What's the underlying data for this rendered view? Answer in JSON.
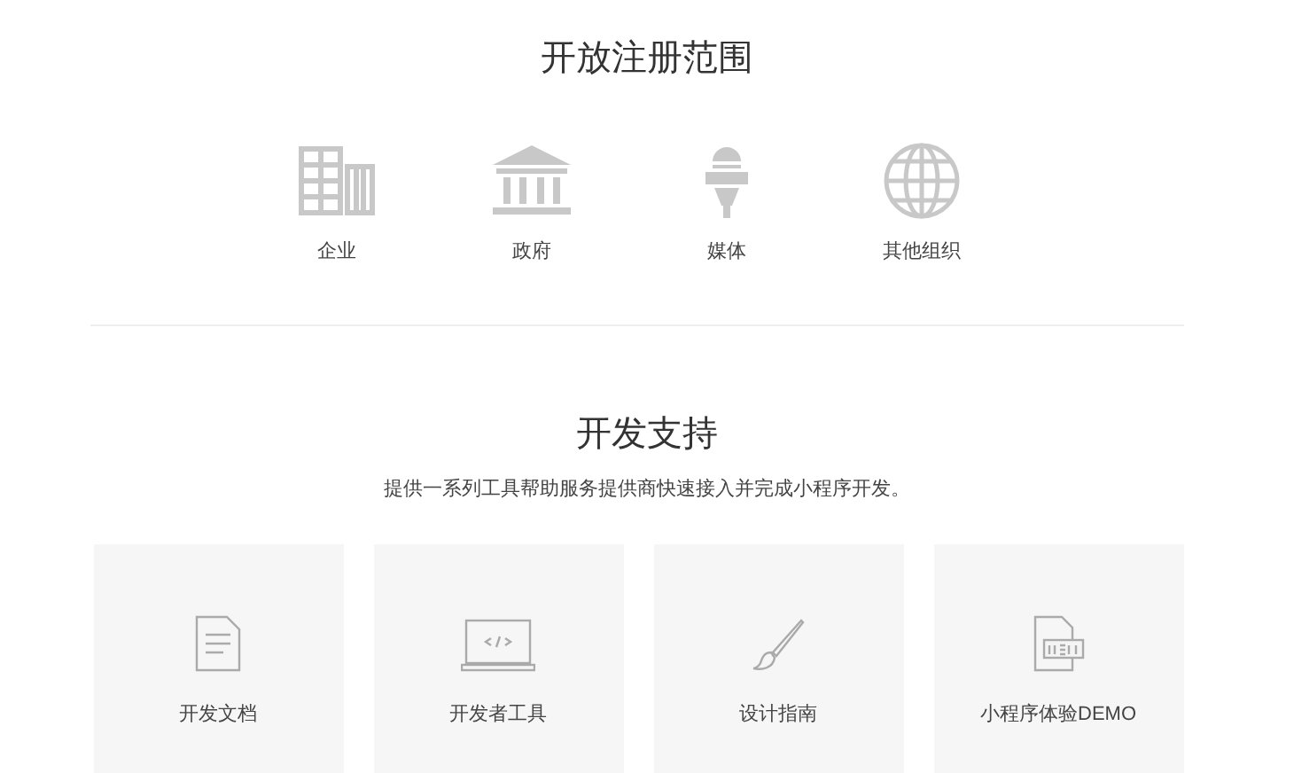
{
  "registration": {
    "title": "开放注册范围",
    "items": [
      {
        "kind": "building",
        "label": "企业"
      },
      {
        "kind": "government",
        "label": "政府"
      },
      {
        "kind": "media",
        "label": "媒体"
      },
      {
        "kind": "globe",
        "label": "其他组织"
      }
    ]
  },
  "support": {
    "title": "开发支持",
    "subtitle": "提供一系列工具帮助服务提供商快速接入并完成小程序开发。",
    "cards": [
      {
        "kind": "document",
        "label": "开发文档"
      },
      {
        "kind": "laptop",
        "label": "开发者工具"
      },
      {
        "kind": "brush",
        "label": "设计指南"
      },
      {
        "kind": "demo",
        "label": "小程序体验DEMO"
      }
    ]
  }
}
